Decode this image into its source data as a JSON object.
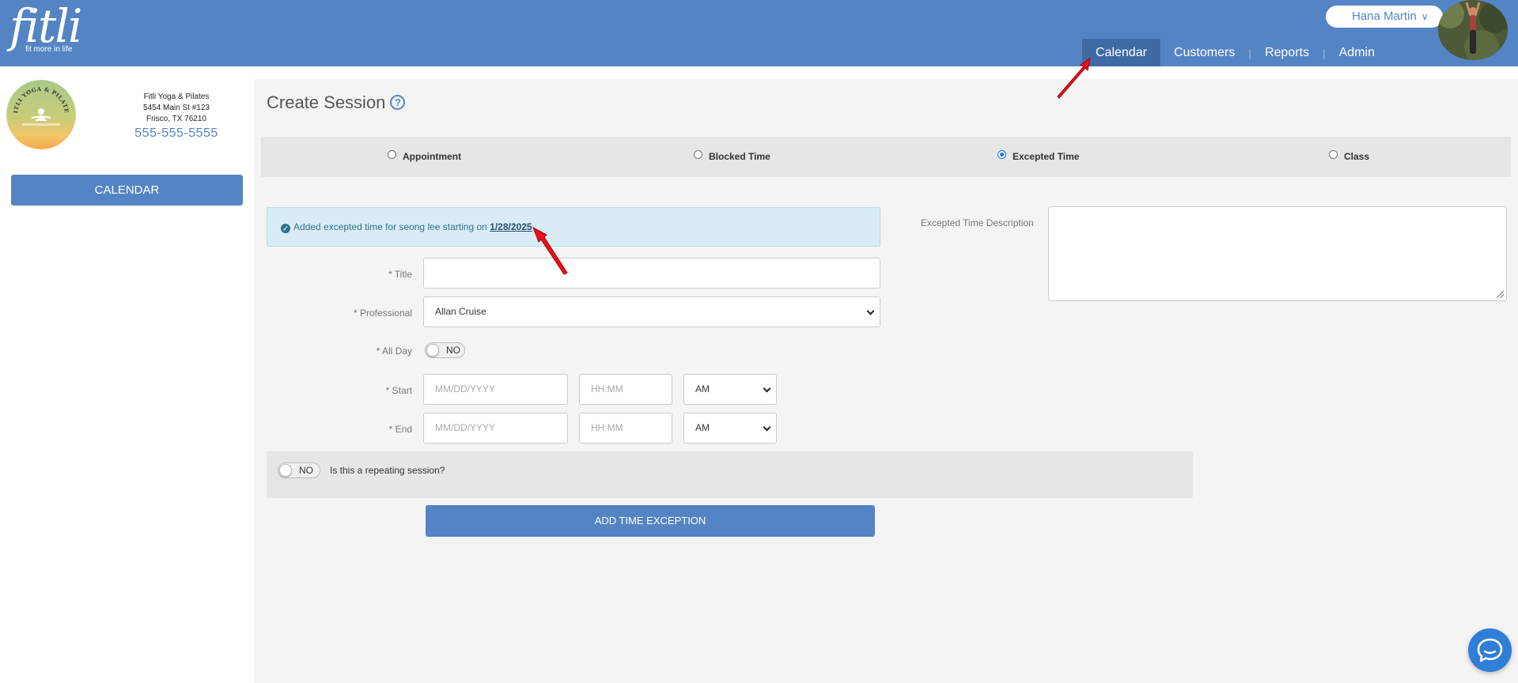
{
  "brand": {
    "name": "fitli",
    "tagline": "fit more in life"
  },
  "user": {
    "name": "Hana Martin"
  },
  "nav": {
    "calendar": "Calendar",
    "customers": "Customers",
    "reports": "Reports",
    "admin": "Admin",
    "active": "Calendar"
  },
  "studio": {
    "name": "Fitli Yoga & Pilates",
    "address1": "5454 Main St #123",
    "address2": "Frisco, TX 76210",
    "phone": "555-555-5555",
    "logo_text": "FITLI YOGA & PILATES"
  },
  "sidebar": {
    "calendar_button": "CALENDAR"
  },
  "page": {
    "title": "Create Session"
  },
  "session_types": {
    "appointment": "Appointment",
    "blocked_time": "Blocked Time",
    "excepted_time": "Excepted Time",
    "class": "Class",
    "selected": "Excepted Time"
  },
  "alert": {
    "message": "Added excepted time for seong lee starting on",
    "link": "1/28/2025"
  },
  "form": {
    "title_label": "* Title",
    "title_value": "",
    "professional_label": "* Professional",
    "professional_value": "Allan Cruise",
    "all_day_label": "* All Day",
    "all_day_value": "NO",
    "start_label": "* Start",
    "end_label": "* End",
    "date_placeholder": "MM/DD/YYYY",
    "time_placeholder": "HH:MM",
    "start_ampm": "AM",
    "end_ampm": "AM",
    "repeat_value": "NO",
    "repeat_question": "Is this a repeating session?",
    "submit_label": "ADD TIME EXCEPTION",
    "description_label": "Excepted Time Description",
    "description_value": ""
  },
  "colors": {
    "brand_blue": "#5584c5",
    "nav_active": "#3f6aa5",
    "alert_bg": "#d9ecf5",
    "annotation_red": "#e8101a",
    "chat_blue": "#2f7ed8"
  },
  "icons": {
    "help": "question-circle-icon",
    "check": "check-circle-icon",
    "chevron": "chevron-down-icon",
    "chat": "chat-bubble-icon",
    "resize": "resize-handle-icon"
  }
}
